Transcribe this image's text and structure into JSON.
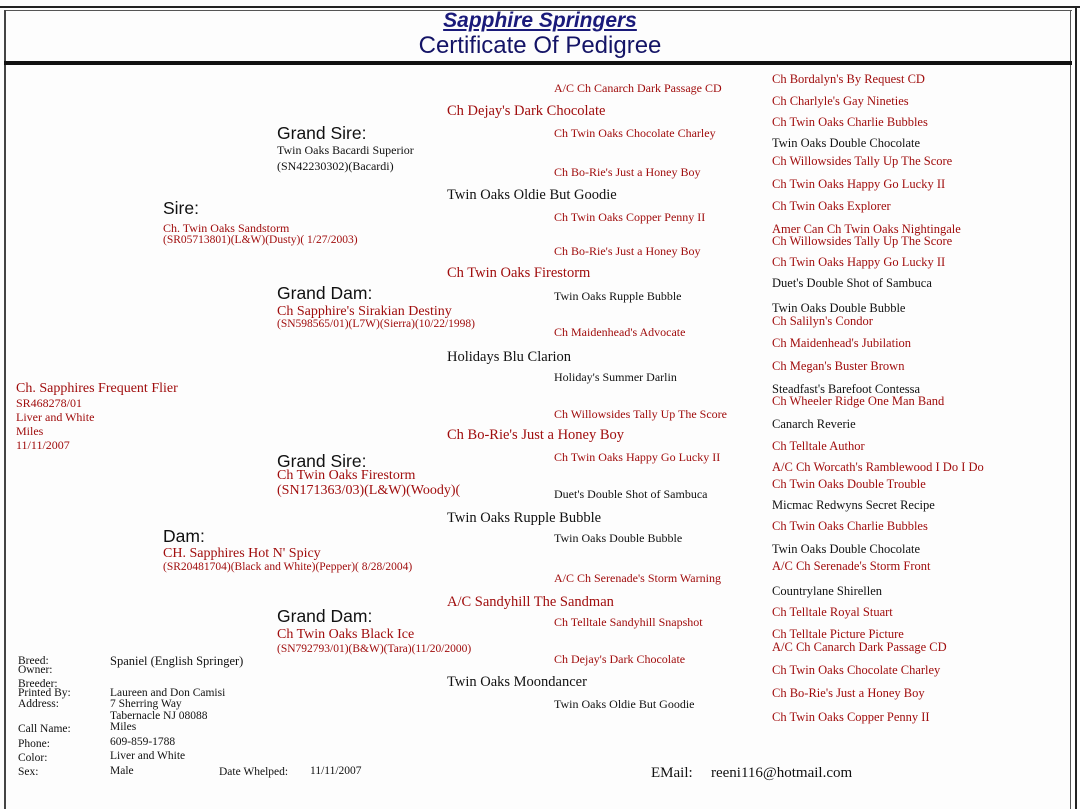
{
  "header": {
    "brand": "Sapphire Springers",
    "title": "Certificate Of Pedigree"
  },
  "colors": {
    "title_blue": "#141466",
    "name_red": "#a00d0d",
    "name_black": "#111111"
  },
  "dog": {
    "name": "Ch. Sapphires Frequent Flier",
    "registration": "SR468278/01",
    "color": "Liver and White",
    "call_name": "Miles",
    "whelped": "11/11/2007"
  },
  "sire": {
    "label": "Sire:",
    "name": "Ch. Twin Oaks Sandstorm",
    "details": "(SR05713801)(L&W)(Dusty)( 1/27/2003)"
  },
  "dam": {
    "label": "Dam:",
    "name": "CH. Sapphires Hot N' Spicy",
    "details": "(SR20481704)(Black and White)(Pepper)( 8/28/2004)"
  },
  "grandparents": [
    {
      "label": "Grand Sire:",
      "name": "Twin Oaks Bacardi Superior",
      "details": "(SN42230302)(Bacardi)"
    },
    {
      "label": "Grand Dam:",
      "name": "Ch Sapphire's Sirakian Destiny",
      "details": "(SN598565/01)(L7W)(Sierra)(10/22/1998)"
    },
    {
      "label": "Grand Sire:",
      "name": "Ch Twin Oaks Firestorm",
      "details": "(SN171363/03)(L&W)(Woody)("
    },
    {
      "label": "Grand Dam:",
      "name": "Ch Twin Oaks Black Ice",
      "details": "(SN792793/01)(B&W)(Tara)(11/20/2000)"
    }
  ],
  "gen3": [
    "Ch Dejay's Dark Chocolate",
    "Twin Oaks Oldie But Goodie",
    "Ch Twin Oaks Firestorm",
    "Holidays Blu Clarion",
    "Ch Bo-Rie's Just a Honey Boy",
    "Twin Oaks Rupple Bubble",
    "A/C Sandyhill The Sandman",
    "Twin Oaks Moondancer"
  ],
  "gen4": [
    "A/C Ch Canarch Dark Passage CD",
    "Ch Twin Oaks Chocolate Charley",
    "Ch Bo-Rie's Just a Honey Boy",
    "Ch Twin Oaks Copper Penny II",
    "Ch Bo-Rie's Just a Honey Boy",
    "Twin Oaks Rupple Bubble",
    "Ch Maidenhead's Advocate",
    "Holiday's Summer Darlin",
    "Ch Willowsides Tally Up The Score",
    "Ch Twin Oaks Happy Go Lucky II",
    "Duet's Double Shot of Sambuca",
    "Twin Oaks Double Bubble",
    "A/C Ch Serenade's Storm Warning",
    "Ch Telltale Sandyhill Snapshot",
    "Ch Dejay's Dark Chocolate",
    "Twin Oaks Oldie But Goodie"
  ],
  "gen5": [
    "Ch Bordalyn's By Request CD",
    "Ch Charlyle's Gay Nineties",
    "Ch Twin Oaks Charlie Bubbles",
    "Twin Oaks Double Chocolate",
    "Ch Willowsides Tally Up The Score",
    "Ch Twin Oaks Happy Go Lucky II",
    "Ch Twin Oaks Explorer",
    "Amer Can Ch Twin Oaks Nightingale",
    "Ch Willowsides Tally Up The Score",
    "Ch Twin Oaks Happy Go Lucky II",
    "Duet's Double Shot of Sambuca",
    "Twin Oaks Double Bubble",
    "Ch Salilyn's Condor",
    "Ch Maidenhead's Jubilation",
    "Ch Megan's Buster Brown",
    "Steadfast's Barefoot Contessa",
    "Ch Wheeler Ridge One Man Band",
    "Canarch Reverie",
    "Ch Telltale Author",
    "A/C Ch Worcath's Ramblewood I Do I Do",
    "Ch Twin Oaks Double Trouble",
    "Micmac Redwyns Secret Recipe",
    "Ch Twin Oaks Charlie Bubbles",
    "Twin Oaks Double Chocolate",
    "A/C Ch Serenade's Storm Front",
    "Countrylane Shirellen",
    "Ch Telltale Royal Stuart",
    "Ch Telltale Picture Picture",
    "A/C Ch Canarch Dark Passage CD",
    "Ch Twin Oaks Chocolate Charley",
    "Ch Bo-Rie's Just a Honey Boy",
    "Ch Twin Oaks Copper Penny II"
  ],
  "info": {
    "breed_label": "Breed:",
    "breed": "Spaniel (English Springer)",
    "owner_label": "Owner:",
    "breeder_label": "Breeder:",
    "printed_by_label": "Printed By:",
    "printed_by": "Laureen and Don Camisi",
    "address_label": "Address:",
    "address_line1": "7 Sherring Way",
    "address_line2": "Tabernacle NJ 08088",
    "call_name_label": "Call Name:",
    "call_name": "Miles",
    "phone_label": "Phone:",
    "phone": "609-859-1788",
    "color_label": "Color:",
    "color": "Liver and White",
    "sex_label": "Sex:",
    "sex": "Male",
    "whelped_label": "Date Whelped:",
    "whelped": "11/11/2007",
    "email_label": "EMail:",
    "email": "reeni116@hotmail.com"
  }
}
